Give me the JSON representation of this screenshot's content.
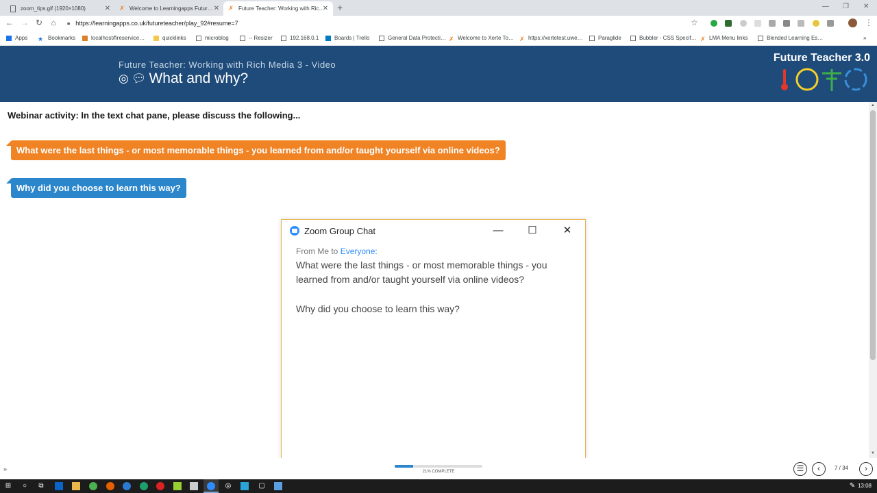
{
  "browser": {
    "tabs": [
      {
        "title": "zoom_tips.gif (1920×1080)",
        "active": false
      },
      {
        "title": "Welcome to Learningapps Futur…",
        "active": false
      },
      {
        "title": "Future Teacher: Working with Ric…",
        "active": true
      }
    ],
    "url": "https://learningapps.co.uk/futureteacher/play_92#resume=7",
    "bookmarks": [
      "Apps",
      "Bookmarks",
      "localhost/fireservice…",
      "quicklinks",
      "microblog",
      "-- Resizer",
      "192.168.0.1",
      "Boards | Trello",
      "General Data Protecti…",
      "Welcome to Xerte To…",
      "https://xertetest.uwe…",
      "Paraglide",
      "Bubbler - CSS Specif…",
      "LMA Menu links",
      "Blended Learning Es…"
    ]
  },
  "header": {
    "subtitle": "Future Teacher: Working with Rich Media 3 - Video",
    "title": "What and why?",
    "brand": "Future Teacher 3.0"
  },
  "content": {
    "instruction": "Webinar activity: In the text chat pane, please discuss the following...",
    "question_1": "What were the last things - or most memorable things - you learned from and/or taught yourself via online videos?",
    "question_2": "Why did you choose to learn this way?"
  },
  "zoom": {
    "window_title": "Zoom Group Chat",
    "from_prefix": "From Me to ",
    "from_recipient": "Everyone:",
    "message_1": "What were the last things - or most memorable things - you learned from and/or taught yourself via online videos?",
    "message_2": "Why did you choose to learn this way?"
  },
  "footer": {
    "progress_label": "21% COMPLETE",
    "progress_percent": 21,
    "page_count": "7 / 34"
  },
  "taskbar": {
    "clock": "13:08"
  },
  "colors": {
    "header_bg": "#1e4b7a",
    "orange_bubble": "#f08324",
    "blue_bubble": "#2b86cb",
    "zoom_border": "#e8b14a",
    "zoom_blue": "#2d8cff"
  }
}
